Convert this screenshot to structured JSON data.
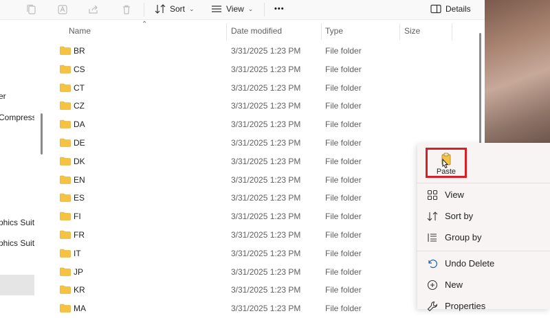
{
  "toolbar": {
    "sort_label": "Sort",
    "view_label": "View",
    "more_label": "•••",
    "details_label": "Details"
  },
  "nav": {
    "items": [
      {
        "label": "er"
      },
      {
        "label": "Compresso"
      },
      {
        "label": "phics Suite"
      },
      {
        "label": "phics Suite"
      }
    ]
  },
  "columns": {
    "name": "Name",
    "date": "Date modified",
    "type": "Type",
    "size": "Size"
  },
  "rows": [
    {
      "name": "BR",
      "date": "3/31/2025 1:23 PM",
      "type": "File folder"
    },
    {
      "name": "CS",
      "date": "3/31/2025 1:23 PM",
      "type": "File folder"
    },
    {
      "name": "CT",
      "date": "3/31/2025 1:23 PM",
      "type": "File folder"
    },
    {
      "name": "CZ",
      "date": "3/31/2025 1:23 PM",
      "type": "File folder"
    },
    {
      "name": "DA",
      "date": "3/31/2025 1:23 PM",
      "type": "File folder"
    },
    {
      "name": "DE",
      "date": "3/31/2025 1:23 PM",
      "type": "File folder"
    },
    {
      "name": "DK",
      "date": "3/31/2025 1:23 PM",
      "type": "File folder"
    },
    {
      "name": "EN",
      "date": "3/31/2025 1:23 PM",
      "type": "File folder"
    },
    {
      "name": "ES",
      "date": "3/31/2025 1:23 PM",
      "type": "File folder"
    },
    {
      "name": "FI",
      "date": "3/31/2025 1:23 PM",
      "type": "File folder"
    },
    {
      "name": "FR",
      "date": "3/31/2025 1:23 PM",
      "type": "File folder"
    },
    {
      "name": "IT",
      "date": "3/31/2025 1:23 PM",
      "type": "File folder"
    },
    {
      "name": "JP",
      "date": "3/31/2025 1:23 PM",
      "type": "File folder"
    },
    {
      "name": "KR",
      "date": "3/31/2025 1:23 PM",
      "type": "File folder"
    },
    {
      "name": "MA",
      "date": "3/31/2025 1:23 PM",
      "type": "File folder"
    }
  ],
  "context_menu": {
    "paste_label": "Paste",
    "items": [
      {
        "label": "View",
        "icon": "grid-icon"
      },
      {
        "label": "Sort by",
        "icon": "sort-icon"
      },
      {
        "label": "Group by",
        "icon": "group-icon"
      },
      {
        "label": "Undo Delete",
        "icon": "undo-icon"
      },
      {
        "label": "New",
        "icon": "plus-circle-icon"
      },
      {
        "label": "Properties",
        "icon": "wrench-icon"
      }
    ]
  },
  "colors": {
    "folder": "#f5c242",
    "highlight": "#d62027"
  }
}
